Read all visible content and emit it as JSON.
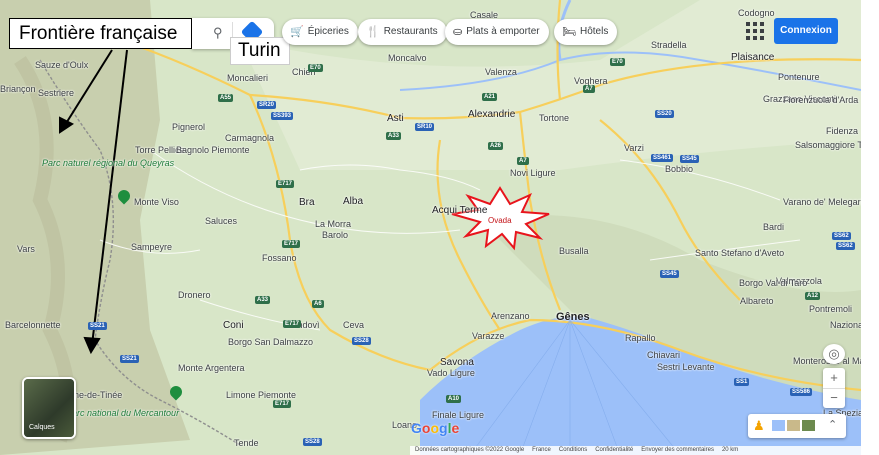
{
  "annotations": {
    "border_label": "Frontière française",
    "turin_label": "Turin"
  },
  "chips": [
    {
      "icon": "grocery-cart-icon",
      "glyph": "🛒",
      "label": "Épiceries"
    },
    {
      "icon": "fork-knife-icon",
      "glyph": "🍴",
      "label": "Restaurants"
    },
    {
      "icon": "takeout-bag-icon",
      "glyph": "⛀",
      "label": "Plats à emporter"
    },
    {
      "icon": "bed-icon",
      "glyph": "🛏",
      "label": "Hôtels"
    }
  ],
  "header": {
    "login_label": "Connexion"
  },
  "map": {
    "highlight_label": "Ovada",
    "cities": [
      {
        "name": "Casale",
        "cls": "lbl"
      },
      {
        "name": "Codogno",
        "cls": "lbl"
      },
      {
        "name": "Moncalvo",
        "cls": "lbl"
      },
      {
        "name": "Valenza",
        "cls": "lbl"
      },
      {
        "name": "Stradella",
        "cls": "lbl"
      },
      {
        "name": "Plaisance",
        "cls": "lbl city"
      },
      {
        "name": "Sauze d'Oulx",
        "cls": "lbl"
      },
      {
        "name": "Moncalieri",
        "cls": "lbl"
      },
      {
        "name": "Chieri",
        "cls": "lbl"
      },
      {
        "name": "Voghera",
        "cls": "lbl"
      },
      {
        "name": "Pontenure",
        "cls": "lbl"
      },
      {
        "name": "Sestriere",
        "cls": "lbl"
      },
      {
        "name": "Asti",
        "cls": "lbl city"
      },
      {
        "name": "Alexandrie",
        "cls": "lbl city"
      },
      {
        "name": "Tortone",
        "cls": "lbl"
      },
      {
        "name": "Grazzano Visconti",
        "cls": "lbl"
      },
      {
        "name": "Fiorenzuola d'Arda",
        "cls": "lbl"
      },
      {
        "name": "Briançon",
        "cls": "lbl"
      },
      {
        "name": "Pignerol",
        "cls": "lbl"
      },
      {
        "name": "Carmagnola",
        "cls": "lbl"
      },
      {
        "name": "Fidenza",
        "cls": "lbl"
      },
      {
        "name": "Torre Pellice",
        "cls": "lbl"
      },
      {
        "name": "Bagnolo Piemonte",
        "cls": "lbl"
      },
      {
        "name": "Novi Ligure",
        "cls": "lbl"
      },
      {
        "name": "Varzi",
        "cls": "lbl"
      },
      {
        "name": "Bobbio",
        "cls": "lbl"
      },
      {
        "name": "Salsomaggiore Terme",
        "cls": "lbl"
      },
      {
        "name": "Bra",
        "cls": "lbl city"
      },
      {
        "name": "Alba",
        "cls": "lbl city"
      },
      {
        "name": "Acqui Terme",
        "cls": "lbl city"
      },
      {
        "name": "Monte Viso",
        "cls": "lbl"
      },
      {
        "name": "Saluces",
        "cls": "lbl"
      },
      {
        "name": "La Morra",
        "cls": "lbl"
      },
      {
        "name": "Barolo",
        "cls": "lbl"
      },
      {
        "name": "Varano de' Melegari",
        "cls": "lbl"
      },
      {
        "name": "Bardi",
        "cls": "lbl"
      },
      {
        "name": "Vars",
        "cls": "lbl"
      },
      {
        "name": "Sampeyre",
        "cls": "lbl"
      },
      {
        "name": "Busalla",
        "cls": "lbl"
      },
      {
        "name": "Santo Stefano d'Aveto",
        "cls": "lbl"
      },
      {
        "name": "Fossano",
        "cls": "lbl"
      },
      {
        "name": "Valmozzola",
        "cls": "lbl"
      },
      {
        "name": "Dronero",
        "cls": "lbl"
      },
      {
        "name": "Borgo Val di Taro",
        "cls": "lbl"
      },
      {
        "name": "Albareto",
        "cls": "lbl"
      },
      {
        "name": "Barcelonnette",
        "cls": "lbl"
      },
      {
        "name": "Coni",
        "cls": "lbl city"
      },
      {
        "name": "Mondovì",
        "cls": "lbl"
      },
      {
        "name": "Ceva",
        "cls": "lbl"
      },
      {
        "name": "Arenzano",
        "cls": "lbl"
      },
      {
        "name": "Gênes",
        "cls": "lbl big"
      },
      {
        "name": "Varazze",
        "cls": "lbl"
      },
      {
        "name": "Pontremoli",
        "cls": "lbl"
      },
      {
        "name": "Borgo San Dalmazzo",
        "cls": "lbl"
      },
      {
        "name": "Rapallo",
        "cls": "lbl"
      },
      {
        "name": "Chiavari",
        "cls": "lbl"
      },
      {
        "name": "Monte Argentera",
        "cls": "lbl"
      },
      {
        "name": "Savona",
        "cls": "lbl city"
      },
      {
        "name": "Vado Ligure",
        "cls": "lbl"
      },
      {
        "name": "Sestri Levante",
        "cls": "lbl"
      },
      {
        "name": "Saint-Étienne-de-Tinée",
        "cls": "lbl"
      },
      {
        "name": "Finale Ligure",
        "cls": "lbl"
      },
      {
        "name": "Loano",
        "cls": "lbl"
      },
      {
        "name": "Limone Piemonte",
        "cls": "lbl"
      },
      {
        "name": "Tende",
        "cls": "lbl"
      },
      {
        "name": "La Spezia",
        "cls": "lbl"
      },
      {
        "name": "Monterosso al Mare",
        "cls": "lbl"
      },
      {
        "name": "Nazionale",
        "cls": "lbl"
      }
    ],
    "parks": [
      {
        "name": "Parc naturel régional du Queyras"
      },
      {
        "name": "Parc national du Mercantour"
      }
    ],
    "roads": [
      "E70",
      "A55",
      "SR20",
      "SS393",
      "E70",
      "A7",
      "A21",
      "SR10",
      "A33",
      "E717",
      "A7",
      "A26",
      "SS461",
      "SS45",
      "E717",
      "A33",
      "A6",
      "E717",
      "SS28",
      "E717",
      "SS21",
      "A10",
      "A12",
      "SS62",
      "SS45",
      "SS586",
      "SS62",
      "SS1",
      "SS28",
      "SS21",
      "SS20"
    ],
    "layers_label": "Calques",
    "google_logo": "Google"
  },
  "footer": {
    "items": [
      "Données cartographiques ©2022 Google",
      "France",
      "Conditions",
      "Confidentialité",
      "Envoyer des commentaires",
      "20 km"
    ]
  },
  "colors": {
    "land": "#d4e2c3",
    "sea": "#9cc0f9",
    "accent": "#1a73e8",
    "highlight": "#e8141c"
  }
}
